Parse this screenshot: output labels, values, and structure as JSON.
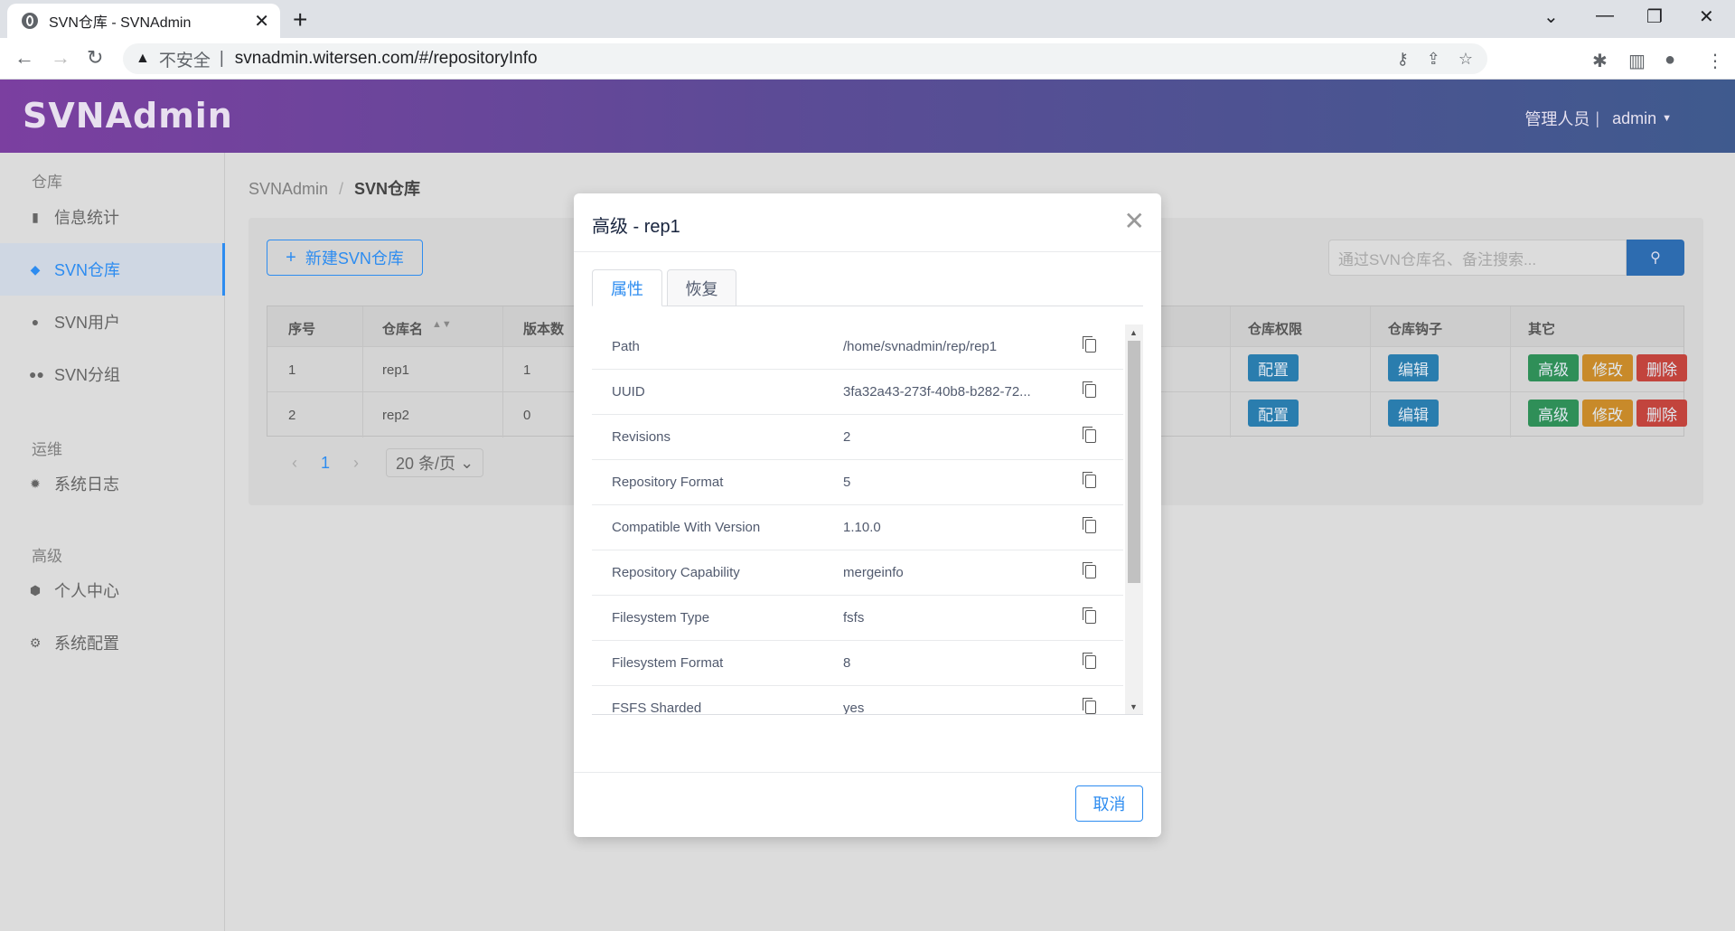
{
  "browser": {
    "tab_title": "SVN仓库 - SVNAdmin",
    "insecure_label": "不安全",
    "url": "svnadmin.witersen.com/#/repositoryInfo"
  },
  "header": {
    "logo": "SVNAdmin",
    "role": "管理人员",
    "user": "admin"
  },
  "sidebar": {
    "group_repo": "仓库",
    "group_ops": "运维",
    "group_adv": "高级",
    "items": [
      {
        "label": "信息统计",
        "icon": "bar-chart-icon"
      },
      {
        "label": "SVN仓库",
        "icon": "layers-icon"
      },
      {
        "label": "SVN用户",
        "icon": "person-icon"
      },
      {
        "label": "SVN分组",
        "icon": "people-icon"
      },
      {
        "label": "系统日志",
        "icon": "bug-icon"
      },
      {
        "label": "个人中心",
        "icon": "cube-icon"
      },
      {
        "label": "系统配置",
        "icon": "gear-icon"
      }
    ]
  },
  "content": {
    "breadcrumb": [
      "SVNAdmin",
      "SVN仓库"
    ],
    "new_button": "新建SVN仓库",
    "search_placeholder": "通过SVN仓库名、备注搜索...",
    "columns": [
      "序号",
      "仓库名",
      "版本数",
      "仓库权限",
      "仓库钩子",
      "其它"
    ],
    "rows": [
      {
        "index": "1",
        "name": "rep1",
        "revisions": "1"
      },
      {
        "index": "2",
        "name": "rep2",
        "revisions": "0"
      }
    ],
    "row_actions": {
      "perm": "配置",
      "hook": "编辑",
      "advanced": "高级",
      "edit": "修改",
      "delete": "删除"
    },
    "pager": {
      "current": "1",
      "page_size": "20 条/页"
    }
  },
  "modal": {
    "title": "高级 - rep1",
    "tabs": [
      "属性",
      "恢复"
    ],
    "properties": [
      {
        "key": "Path",
        "value": "/home/svnadmin/rep/rep1"
      },
      {
        "key": "UUID",
        "value": "3fa32a43-273f-40b8-b282-72..."
      },
      {
        "key": "Revisions",
        "value": "2"
      },
      {
        "key": "Repository Format",
        "value": "5"
      },
      {
        "key": "Compatible With Version",
        "value": "1.10.0"
      },
      {
        "key": "Repository Capability",
        "value": "mergeinfo"
      },
      {
        "key": "Filesystem Type",
        "value": "fsfs"
      },
      {
        "key": "Filesystem Format",
        "value": "8"
      },
      {
        "key": "FSFS Sharded",
        "value": "yes"
      }
    ],
    "cancel": "取消"
  },
  "colors": {
    "primary": "#2d8cf0",
    "header_start": "#7b3fa0",
    "header_end": "#3f5a8e"
  }
}
